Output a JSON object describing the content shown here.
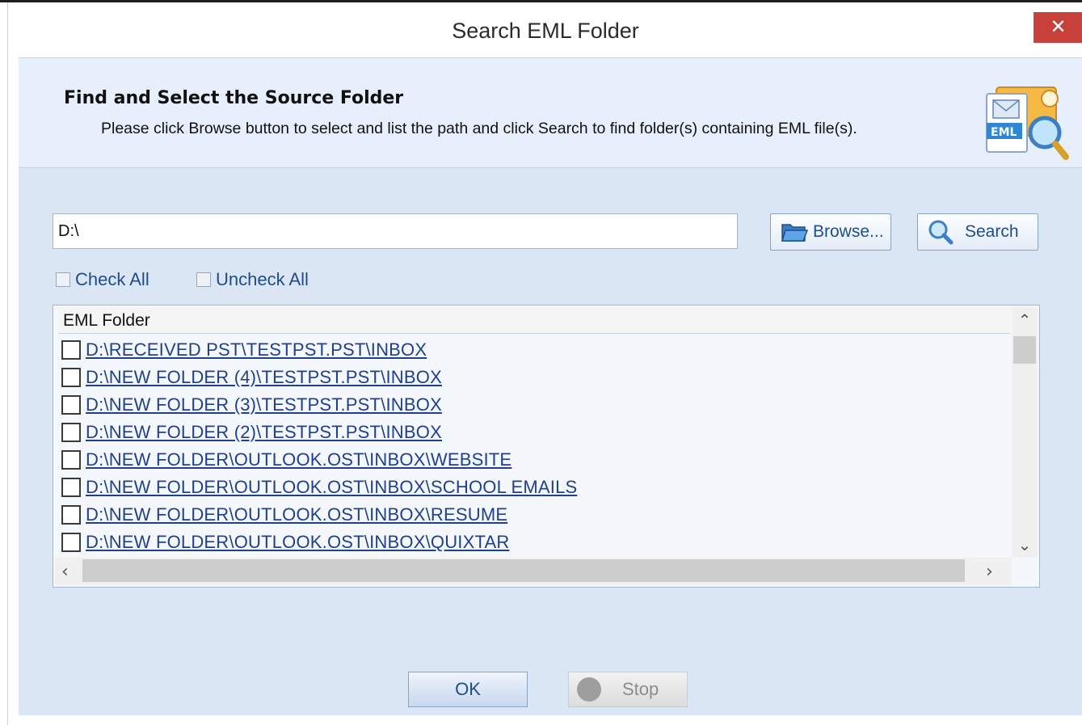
{
  "window": {
    "title": "Search EML Folder",
    "close_glyph": "✕"
  },
  "header": {
    "title": "Find and Select the Source Folder",
    "description": "Please click Browse button to select and list the path and click Search to find folder(s) containing EML file(s).",
    "logo_text": "EML"
  },
  "path_input": {
    "value": "D:\\"
  },
  "buttons": {
    "browse": "Browse...",
    "search": "Search",
    "ok": "OK",
    "stop": "Stop"
  },
  "checks": {
    "check_all": "Check All",
    "uncheck_all": "Uncheck All"
  },
  "list": {
    "column_header": "EML Folder",
    "rows": [
      "D:\\RECEIVED PST\\TESTPST.PST\\INBOX",
      "D:\\NEW FOLDER (4)\\TESTPST.PST\\INBOX",
      "D:\\NEW FOLDER (3)\\TESTPST.PST\\INBOX",
      "D:\\NEW FOLDER (2)\\TESTPST.PST\\INBOX",
      "D:\\NEW FOLDER\\OUTLOOK.OST\\INBOX\\WEBSITE",
      "D:\\NEW FOLDER\\OUTLOOK.OST\\INBOX\\SCHOOL EMAILS",
      "D:\\NEW FOLDER\\OUTLOOK.OST\\INBOX\\RESUME",
      "D:\\NEW FOLDER\\OUTLOOK.OST\\INBOX\\QUIXTAR"
    ]
  },
  "colors": {
    "accent": "#1f4d8a",
    "close": "#c7413a",
    "panel": "#dbe6f4"
  }
}
